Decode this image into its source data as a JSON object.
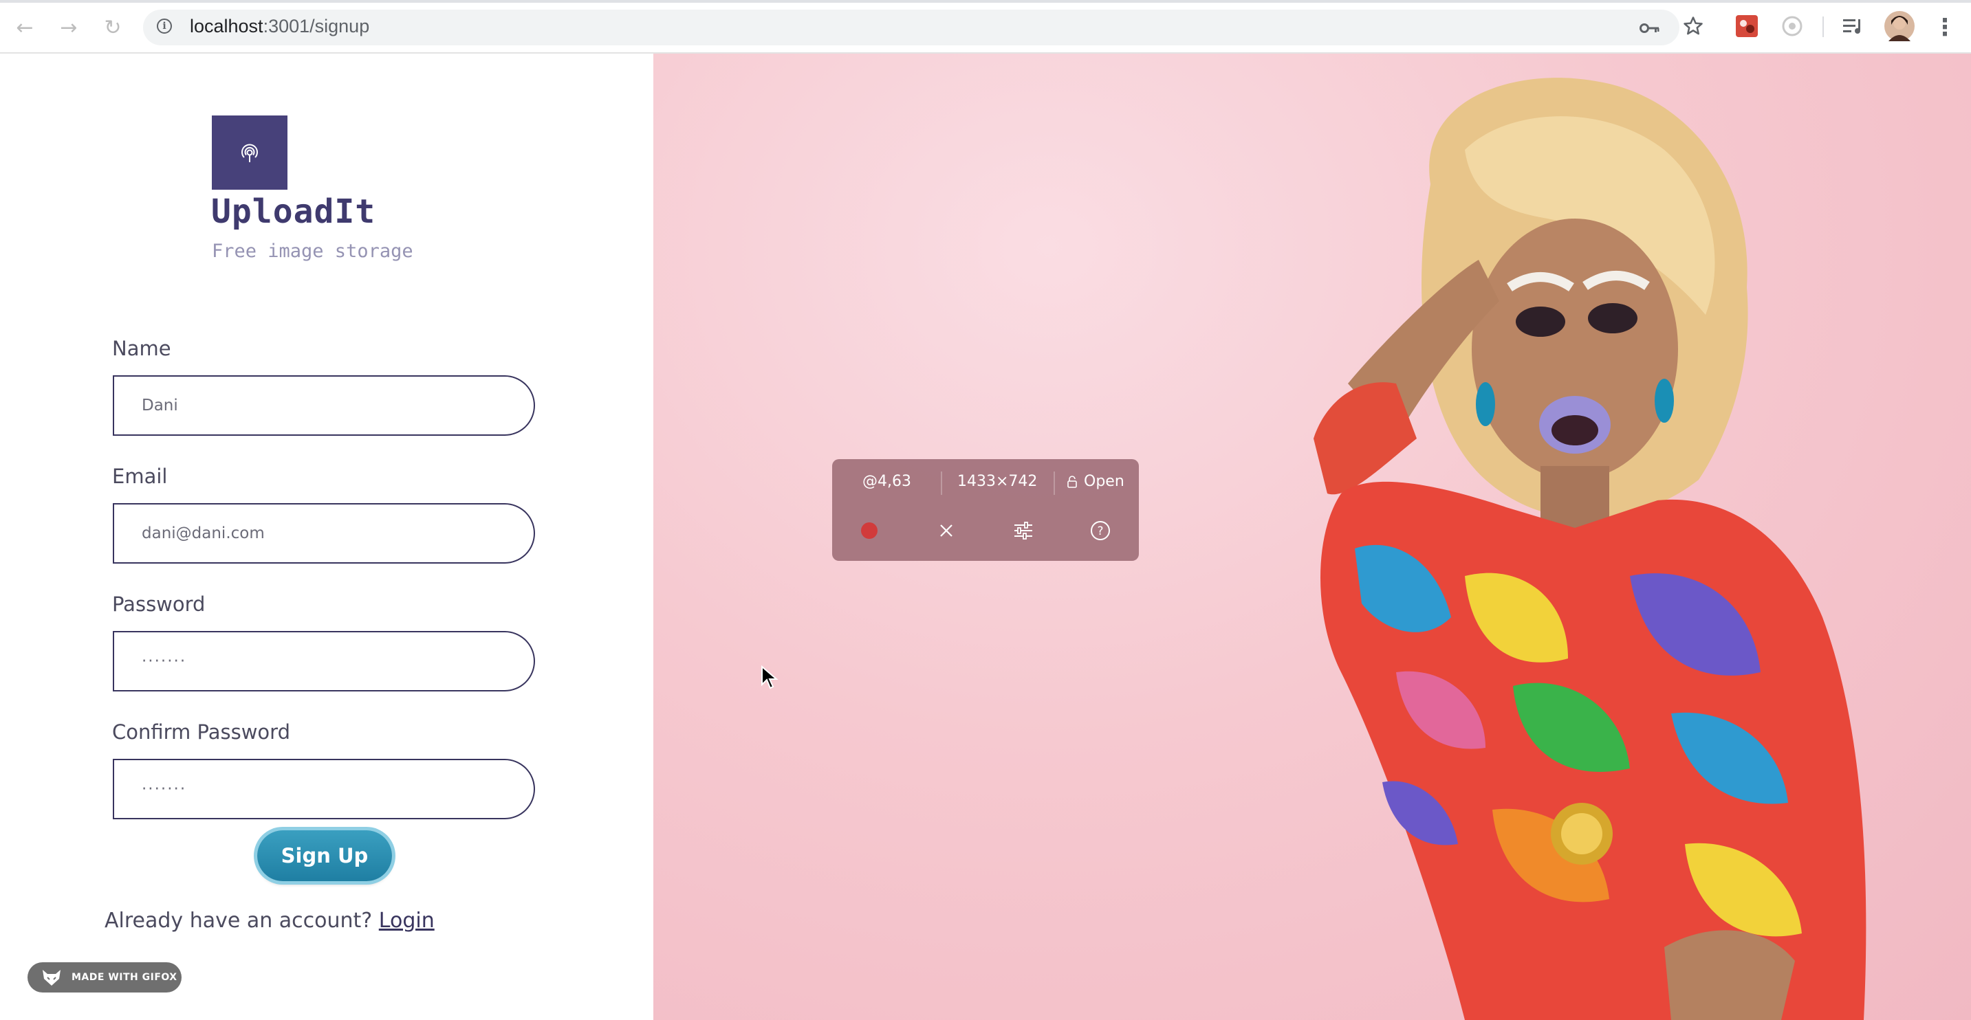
{
  "browser": {
    "back_icon": "arrow-left-icon",
    "forward_icon": "arrow-right-icon",
    "reload_icon": "reload-icon",
    "url_host": "localhost",
    "url_path": ":3001/signup"
  },
  "brand": {
    "name": "UploadIt",
    "tagline": "Free image storage",
    "logo_icon": "broadcast-icon",
    "logo_color": "#47417a"
  },
  "form": {
    "name_label": "Name",
    "name_value": "Dani",
    "email_label": "Email",
    "email_value": "dani@dani.com",
    "password_label": "Password",
    "password_value": "·······",
    "confirm_label": "Confirm Password",
    "confirm_value": "·······",
    "submit_label": "Sign Up",
    "login_prompt": "Already have an account?",
    "login_link": "Login"
  },
  "gifox": {
    "badge": "MADE WITH GIFOX",
    "position": "@4,63",
    "size": "1433×742",
    "open_label": "Open"
  },
  "colors": {
    "accent": "#1f7fa3",
    "record": "#d13b3b",
    "input_border": "#38345e"
  }
}
